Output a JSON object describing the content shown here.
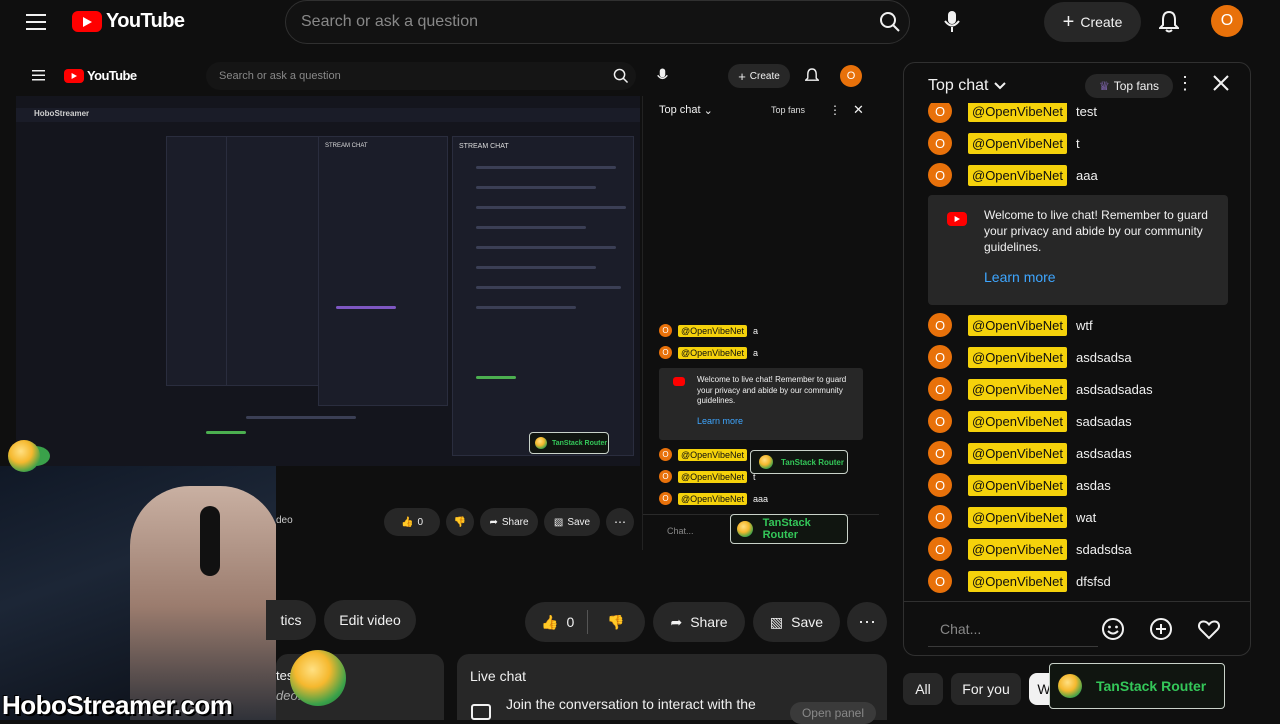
{
  "masthead": {
    "logo_text": "YouTube",
    "search_placeholder": "Search or ask a question",
    "create_label": "Create",
    "avatar_letter": "O"
  },
  "embedded_masthead": {
    "logo_text": "YouTube",
    "search_placeholder": "Search or ask a question",
    "create_label": "Create",
    "avatar_letter": "O"
  },
  "embedded_capture": {
    "site_name": "HoboStreamer",
    "stream_chat_title": "STREAM CHAT",
    "toast_label": "TanStack Router"
  },
  "embedded_player_actions": {
    "like_count": "0",
    "share_label": "Share",
    "save_label": "Save",
    "clipped_label": "deo"
  },
  "mini_chat": {
    "title": "Top chat",
    "top_fans": "Top fans",
    "messages": [
      {
        "user": "@OpenVibeNet",
        "text": "a"
      },
      {
        "user": "@OpenVibeNet",
        "text": "a"
      }
    ],
    "welcome_text": "Welcome to live chat! Remember to guard your privacy and abide by our community guidelines.",
    "learn_more": "Learn more",
    "after": [
      {
        "user": "@OpenVibeNet",
        "text": ""
      },
      {
        "user": "@OpenVibeNet",
        "text": "t"
      },
      {
        "user": "@OpenVibeNet",
        "text": "aaa"
      }
    ],
    "input_placeholder": "Chat...",
    "avatar_letter": "O"
  },
  "floating_toasts": {
    "mini_toast": "TanStack Router",
    "embedded_toast": "TanStack Router",
    "main_toast": "TanStack Router"
  },
  "video_actions": {
    "analytics_label": "tics",
    "edit_video_label": "Edit video",
    "like_count": "0",
    "share_label": "Share",
    "save_label": "Save"
  },
  "live_chat_card": {
    "title": "Live chat",
    "body": "Join the conversation to interact with the",
    "open_panel": "Open panel",
    "clipped_text_1": "tes",
    "clipped_text_2": "deo."
  },
  "chat": {
    "title": "Top chat",
    "top_fans": "Top fans",
    "avatar_letter": "O",
    "top_messages": [
      {
        "user": "@OpenVibeNet",
        "text": "test"
      },
      {
        "user": "@OpenVibeNet",
        "text": "t"
      },
      {
        "user": "@OpenVibeNet",
        "text": "aaa"
      }
    ],
    "welcome_text": "Welcome to live chat! Remember to guard your privacy and abide by our community guidelines.",
    "learn_more": "Learn more",
    "messages": [
      {
        "user": "@OpenVibeNet",
        "text": "wtf"
      },
      {
        "user": "@OpenVibeNet",
        "text": "asdsadsa"
      },
      {
        "user": "@OpenVibeNet",
        "text": "asdsadsadas"
      },
      {
        "user": "@OpenVibeNet",
        "text": "sadsadas"
      },
      {
        "user": "@OpenVibeNet",
        "text": "asdsadas"
      },
      {
        "user": "@OpenVibeNet",
        "text": "asdas"
      },
      {
        "user": "@OpenVibeNet",
        "text": "wat"
      },
      {
        "user": "@OpenVibeNet",
        "text": "sdadsdsa"
      },
      {
        "user": "@OpenVibeNet",
        "text": "dfsfsd"
      }
    ],
    "input_placeholder": "Chat..."
  },
  "chips": {
    "all": "All",
    "for_you": "For you",
    "clipped": "W"
  },
  "watermark": "HoboStreamer.com",
  "colors": {
    "accent_red": "#ff0000",
    "avatar_orange": "#e8710a",
    "member_tag_yellow": "#f5d20b",
    "link_blue": "#3ea6ff",
    "toast_green": "#34c759"
  }
}
